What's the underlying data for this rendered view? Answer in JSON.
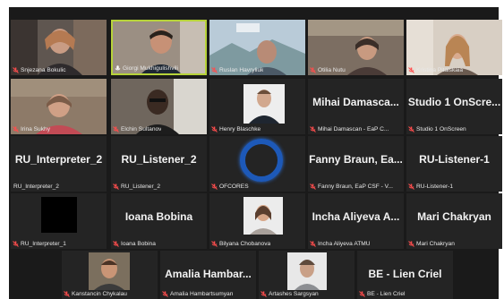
{
  "participants": [
    {
      "name": "Snjezana Bokulic",
      "muted": true,
      "video": "camera"
    },
    {
      "name": "Giorgi Mukhigulishvili",
      "muted": false,
      "speaking": true,
      "video": "camera"
    },
    {
      "name": "Ruslan Havryliuk",
      "muted": true,
      "video": "camera"
    },
    {
      "name": "Otilia Nutu",
      "muted": true,
      "video": "camera"
    },
    {
      "name": "Kristina Pitalskaia",
      "muted": true,
      "video": "camera"
    },
    {
      "name": "Irina Sukhy",
      "muted": true,
      "video": "camera"
    },
    {
      "name": "Elchin Sultanov",
      "muted": true,
      "video": "camera"
    },
    {
      "name": "Henry Blaschke",
      "muted": true,
      "video": "profile-picture"
    },
    {
      "display": "Mihai Damasca...",
      "name": "Mihai Damascan - EaP C...",
      "muted": true,
      "video": "off"
    },
    {
      "display": "Studio 1 OnScre...",
      "name": "Studio 1 OnScreen",
      "muted": true,
      "video": "off"
    },
    {
      "display": "RU_Interpreter_2",
      "name": "RU_Interpreter_2",
      "muted": false,
      "video": "off"
    },
    {
      "display": "RU_Listener_2",
      "name": "RU_Listener_2",
      "muted": true,
      "video": "off"
    },
    {
      "name": "OFCORES",
      "muted": true,
      "video": "profile-picture"
    },
    {
      "display": "Fanny Braun, Ea...",
      "name": "Fanny Braun, EaP CSF - V...",
      "muted": true,
      "video": "off"
    },
    {
      "display": "RU-Listener-1",
      "name": "RU-Listener-1",
      "muted": true,
      "video": "off"
    },
    {
      "name": "RU_Interpreter_1",
      "muted": true,
      "video": "black"
    },
    {
      "display": "Ioana Bobina",
      "name": "Ioana Bobina",
      "muted": true,
      "video": "off"
    },
    {
      "name": "Bilyana Chobanova",
      "muted": true,
      "video": "profile-picture"
    },
    {
      "display": "Incha Aliyeva A...",
      "name": "Incha Aliyeva ATMU",
      "muted": true,
      "video": "off"
    },
    {
      "display": "Mari Chakryan",
      "name": "Mari Chakryan",
      "muted": true,
      "video": "off"
    },
    {
      "name": "Kanstancin Chykalau",
      "muted": true,
      "video": "profile-picture"
    },
    {
      "display": "Amalia Hambar...",
      "name": "Amalia Hambartsumyan",
      "muted": true,
      "video": "off"
    },
    {
      "name": "Artashes Sargsyan",
      "muted": true,
      "video": "profile-picture"
    },
    {
      "display": "BE - Lien Criel",
      "name": "BE - Lien Criel",
      "muted": true,
      "video": "off"
    }
  ],
  "colors": {
    "gallery_background": "#1a1a1a",
    "tile_background": "#242424",
    "active_speaker_border": "#b7d33a",
    "muted_icon": "#ff4d4d"
  }
}
